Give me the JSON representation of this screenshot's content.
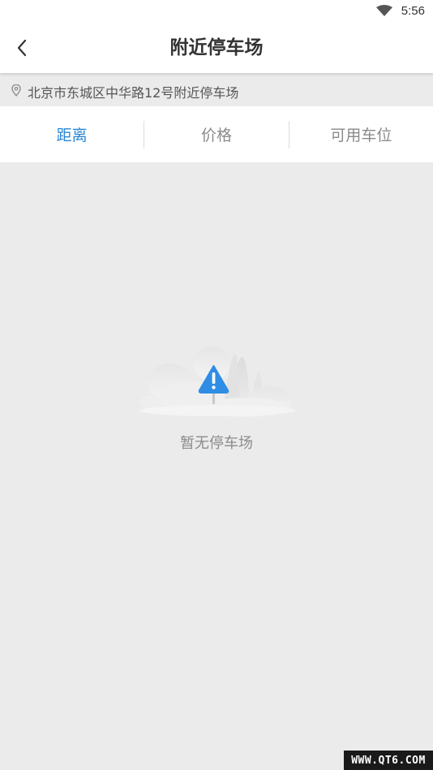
{
  "status_bar": {
    "time": "5:56",
    "wifi_icon": "wifi-icon"
  },
  "header": {
    "title": "附近停车场",
    "back_icon": "chevron-left-icon"
  },
  "location": {
    "icon": "location-pin-icon",
    "address": "北京市东城区中华路12号附近停车场"
  },
  "sort_tabs": [
    {
      "label": "距离",
      "active": true
    },
    {
      "label": "价格",
      "active": false
    },
    {
      "label": "可用车位",
      "active": false
    }
  ],
  "empty_state": {
    "icon": "warning-sign-icon",
    "message": "暂无停车场"
  },
  "watermark": {
    "text": "WWW.QT6.COM"
  },
  "colors": {
    "accent": "#2a86d5",
    "warning": "#2f8de4",
    "background": "#ebebeb"
  }
}
